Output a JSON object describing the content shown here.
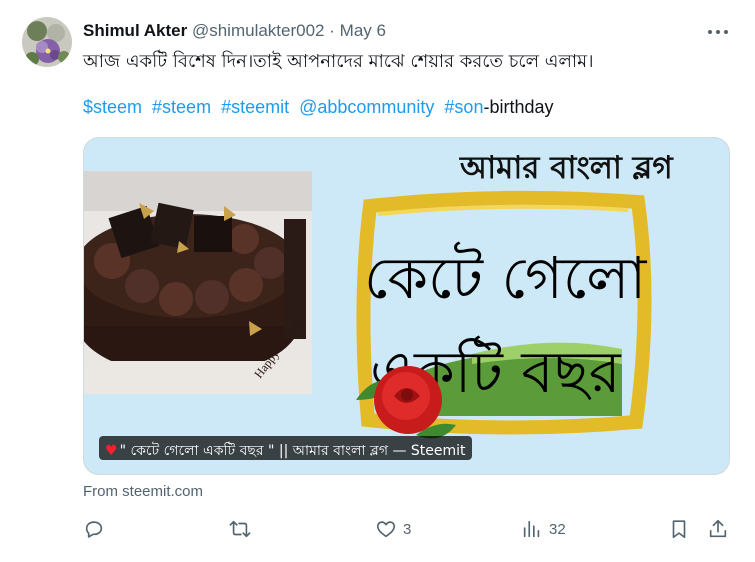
{
  "tweet": {
    "author_name": "Shimul Akter",
    "author_handle": "@shimulakter002",
    "separator": "·",
    "date": "May 6",
    "text": "আজ একটি বিশেষ দিন।তাই আপনাদের মাঝে শেয়ার করতে চলে এলাম।",
    "hashtags": [
      "$steem",
      "#steem",
      "#steemit",
      "@abbcommunity",
      "#son"
    ],
    "hashtag_suffix": "-birthday"
  },
  "card": {
    "header_text": "আমার বাংলা ব্লগ",
    "big_line1": "কেটে গেলো",
    "big_line2": "একটি বছর",
    "photo_inscription": "Happy RAVIN",
    "caption": "\" কেটে গেলো একটি বছর \" || আমার বাংলা ব্লগ — Steemit",
    "source": "From steemit.com"
  },
  "actions": {
    "reply_count": "",
    "retweet_count": "",
    "like_count": "3",
    "views_count": "32"
  },
  "icons": {
    "reply": "reply-icon",
    "retweet": "retweet-icon",
    "like": "heart-icon",
    "views": "views-icon",
    "bookmark": "bookmark-icon",
    "share": "share-icon",
    "more": "more-icon"
  },
  "colors": {
    "accent": "#1d9bf0",
    "secondary_text": "#536471",
    "card_background": "#cde9f7"
  }
}
